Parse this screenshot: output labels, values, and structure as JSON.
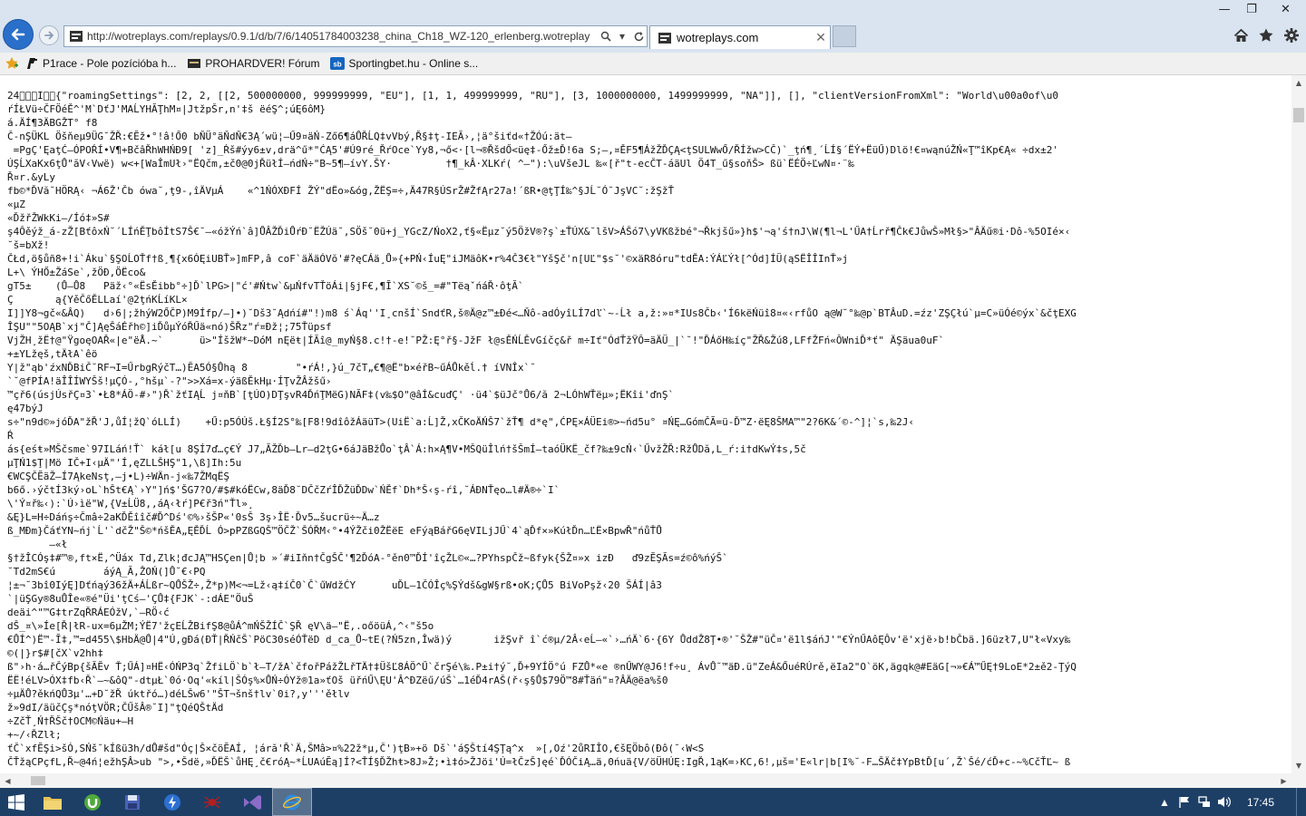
{
  "window": {
    "minimize_glyph": "—",
    "restore_glyph": "❐",
    "close_glyph": "✕"
  },
  "address_bar": {
    "url": "http://wotreplays.com/replays/0.9.1/d/b/7/6/14051784003238_china_Ch18_WZ-120_erlenberg.wotreplay"
  },
  "tab": {
    "title": "wotreplays.com",
    "close_glyph": "✕"
  },
  "favorites": [
    {
      "label": "P1race - Pole pozícióba h...",
      "icon": "p1race-icon",
      "color": "#1a1a1a"
    },
    {
      "label": "PROHARDVER! Fórum",
      "icon": "prohardver-icon",
      "color": "#2b2b2b"
    },
    {
      "label": "Sportingbet.hu - Online s...",
      "icon": "sportingbet-icon",
      "color": "#1565c0"
    }
  ],
  "content": {
    "lines": [
      "24\u0000\u0000\u0000I\u0000\u0000{\"roamingSettings\": [2, 2, [[2, 500000000, 999999999, \"EU\"], [1, 1, 499999999, \"RU\"], [3, 1000000000, 1499999999, \"NA\"]], [], \"clientVersionFromXml\": \"World\\u00a0of\\u0",
      "ŕÍŁVü÷ČFÖéĚ^'M`DťJ'MAĹYHĂŢhM¤|JtžpŠr,n'‡š ëéŞ^;úĘ6ôM}",
      "á.ÄÍ¶3ÄBGŽT° f8",
      "Č-nŞÜKL Öšňeµ9ÜG˘ŽŘ:€Ĕž•°!â!Ő0 bŇÜ°äŇdŇ€3Ą´wü¦–Ű9¤äŃ-Ző6¶áŮŘĹQ‡vVbý,Ř§‡ţ-IEĂ›,¦ä°šiťd«†ŽÓú:ät–",
      " =PgÇ'ĘaţĆ–ÓPOŔÍ•V¶+BčâŘhWHŃĐ9[ 'z]_Ŕš#ýy6±v,drä^ű*\"ĆĄ5'#Ú9ré_ŘŕOce`Yy8,¬ő<·[l¬®ŘšdŐ<üę‡-Őž±Ď!6a S;—,¤ĚF5¶ÁžŽĎÇĄ<ţSULWwŐ/ŘÍžw>CČ)`_ţń¶¸´ĹÍ§´ËÝ+ËüŰ)Dlö!€¤wąnúŽŃ«Ţ™îKp€Ą« ÷dx±2'",
      "ÚŞĹXaKx6ţŮ\"ăV‹Vwë) w<+[WaÎmUł›\"ËQčm,±č0@0jŘüłÍ–ńdŃ÷\"B~5¶–ívY.ŠY·         †¶_kÂ·XLKŕ( ^—\"):\\uVšeJL ‰«[ř\"t-ecČT-áäUl Ö4T_ű§soňŠ> ßü`ËÉÖ÷ĽwN¤·¨‰",
      "Ř¤r.&yLy",
      "fb©*ĎVă˘HÖRĄ‹ ¬Á6Ž'Čb ówa˘,ţ9-,îÄVµÁ    «^1ŃÓXĐFÍ ŽÝ\"dËo»&óg,ŽËŞ=÷,Ä47R§ÚSrŽ#ŽfĄr27a!´ßR•@ţŢÍ‰^§JĹ˘Ó˘JşVC˘:žŞžŤ",
      "«µZ",
      "«ĎžřŽWkKi–/Íó‡»S#",
      "ş4Ôěýž_á-zŽ[BťôxŃ˘´LÍńĚŢbôÍtS7Š€˘—«óžÝń`â]ŮÂŽĎiŮŕĐ˘ËŽÚä˘,SÖš˘0ü+j_YGcZ/ŃoX2,ť§«Ëµz˘ý5ÖžV®?ş`±ŤÚX&˘lšV>ÁŠó7\\yVKßžbé°¬Řkjšű»}h$'¬ą'ś†nJ\\W(¶l¬L'ŰA†Ĺrř¶Čk€JůwŠ»Mł§>\"ÂÄű®i·Dô-%5OIé×‹",
      "˘š=bXž!",
      "ČŁd,ö§ůñ8+!i`Áku`§ŞOĹOŤf†ß¸¶{x6ÓĘiUBŤ»]mFP,â coF`äÄäÓVŏ'#?ęCÁä¸Ů»{+PŃ‹ÍuĘ\"iJMäôK•r%4Č3€ł\"YšŞč'n[UĽ\"$s˘'©xäR8óru\"tdĚA:ÝÁĽÝł[^Ód]ÍÜ(ąSËÎÎInŤ»j",
      "L+\\ ÝHŐ±ŽáSe`,žÖĐ,ÖËco&",
      "gT5±    (Ů–Ů8   Päž‹°«ËsĚibb°÷]Ď`lPG>|\"ć'#Ńtw`&µŃfvTŤöÁi|§jF€,¶Ĩ`XS˘©š_=#\"TëąˇńáŘ·ôţĂ`",
      "Ç       ą{YěČőĚLLaí'@2ţńKĹíKL×",
      "I]]Y8¬gč«&ÂQ)   d›6|;žhýW2ŐČP)M9Ífp/—]•)˘Dš3˘Ądńí#\"!)m8 ś`Áq''I¸cnšÍ`SndťR,š®Ä@z™±Đé<…Ňô-adÓyîLÍ7dľ`~-Ĺł a,ž:»¤*IUs8Čb‹'Í6këŃüî8¤«‹rfůO ą@W˘°‰@p`BTÂuD.=źz'ZŞÇłú`µ=C»üÓé©ýx`&čţEXG",
      "ÎŞU\"\"5OĄB`xj\"Č]ĄęŠáÉřh©]iĎůµÝóŘŰä«nó)ŠŘz\"ŕ¤Đž¦;75Ťüpsf",
      "VjŽH¸žË†@\"ŸgoęOAŘ«|e\"ëÅ.~`      ü>\"ÍšžW*~DóM nĘëŧ|ÍĂî@_myŃ§8.c!†-e!˘PŽ:Ę°ř§-JžF ł@sĚŃĹĚvGíčç&ř m÷Iť\"ÓdŤžŸÔ=äÄÜ_|`˘!\"ĎÁőH‰íç\"ŽŘ&Žú8,LFfŽFń«ÔWniĎ*ť\" ÄŞäua0uF`",
      "+±YLžęš,tÄłA`êö",
      "Y|ž\"ąb'źxNĎBiČ˘RF¬I=ŰrbgRýčT…)ĔA5Ó§Ůhą 8        \"•ŕÁ!,}ú_7čT„€¶@Ë\"b×éřB~űÁŮkěĺ.† íVNÎx`˘",
      "`˘@fPÍA!äÎÎÍWYŠš!µÇÓ-,°hšµ`-?\">>Xá=x-ýäßĚkHµ·ÍŢvŽÂžšű›",
      "™çř6(úsjÚsřÇ¤3`•Ł8*ÁÖ-#›\")Ř`žťIĄĹ j¤ňB`[ţÚO)DŢşvR4ĎńŢMëG)NĂF‡(v‰$O\"@âÍ&cuďÇ' ·ü4`$üJč°Ů6/ă 2¬LÓhWŤëµ»;ËKîi'ďnŞ`",
      "ę47býJ",
      "s÷\"n9d©»jóĎA\"žŘ'J,ůÍ¦žQ`óLLÍ)    +Ű:p5ÓÚš.Ł§Í2S°‰[F8!9dîôžÁäüT>(UiË`a:Ĺ]Ž,xČKoÄŃŠ7`žŤ¶ d*ę\",ĆPĘ×ÁÜEi®>~ńd5u° ¤ŃĘ…GómČÃ=ü-Ď™Z·ëĘ8ŠMA™\"2?6K&´©-^]¦`s,‰2J‹",
      "Ŕ",
      "ás{eśŧ»MŠčsme`97ILáń!Ť` káł[u 8ŞÍ7ď…ç€Ý J7„ĂŽĎb—Lr—d2ţG•6áJäBžŮo`ţÂ`Á:h×Ą¶V•MŠQüÎlń†šŠmÍ–taóÜKË_čf?‰±9cŃ‹`ŰvžŽŘ:RžŮDă,L_ŕ:i†dKwÝ‡s,5č",
      "µŢŃ1$Ţ|Mö IČ+I‹µÄ\"'Í,ęZLLŠHŞ\"1,\\ß]Ih:5u",
      "€WCŞČĔäŽ–Í7ĄkeNsţ,–j•L)÷WÄn-j«‰7ŽMqËŞ",
      "b6ő.›ýčtÍ3ký›oL`hŠt€Ą`›Y\"]ń$'ŠG7?O/#$#kóËCw,8äĎ8˘DČčZŕÎĎŽüĎDw`ŃĚf`Dh*Š‹ş-ŕî,˘ÁĐNŤęo…l#Ä®÷`I`",
      "\\'Ý¤ř‰‹):`Ú›ìë\"W,{V±ĹÜ8,,áĄ‹łŕ]P€ř3ń\"Ťl»¸",
      "&Ę}L=H÷Dáńş÷Čmâ÷2aKĎĚîîč#Ď^Dś'©%›šŠP«'0sŠ 3ş›ÎË·Ďv5…šucrü÷~Ä…z",
      "ß_MĐm}ČáťYN~ńj`Ĺ'`dčŽ\"Š©*ńšĚA„ĘĚĎĹ Ó>pPZßGQŠ™ÖČŽ`ŠÓŘM‹°•4ÝŽči0ŽËëE eFýąBářG6ęVILjJŰ`4`ąĎf×»KúłĎn…ĽË×BpwŘ\"ńůŤŮ",
      "       –«ł",
      "§†žÎCÓş‡#™®,ft×Ë,^Üáx Td,Zlk¦đcJĄ™HSÇen|Ů¦b »´#iIňn†ČgŠČ'¶2ĎóA-°ěn0™ĎÍ'îçŽL©«…?PYhspČž~ßfyk{ŠŽ¤»x izĐ   ď9zĔŞĂs=ź©ô%ńýŠ`",
      "˘Td2mS€ú        áýĄ_Ă,ŽOŃ(]Ů˘€‹PQ",
      "¦±¬˘3bî0IýĘ]Dťńąý36žÄ+ÁĹßr~QŮŠŽ÷,Ž*p)M<¬=Lž‹ą‡íČ0`Č`űWdžĆY      uĎL–1ČÓÎç%ŞÝdš&gW§rß•oK;ÇŮ5 BiVoPşž‹20 ŠÁÍ|â3",
      "`|üŞGy®8uŮÎe«®é\"Üi'ţCś–'ÇŮ‡{FJK`-:dÁE\"ÖuŠ",
      "deäi^\"™G‡trZqŘRÁEÓžV,`—RÖ‹ć",
      "dŠ_¤\\»Íe[Ř|łR-ux=6µŽM;ÝË7'žçEĹŽBifŞ8@ůÁ^mŃŠŽÍČ`ŞŘ ęV\\ä—\"Ë,.oőöüÁ,^‹\"š5o",
      "€ŮÍ^)Ë™-Ĩ‡,™=d455\\$HbÄ@Ů|4\"Ú,gĐá(ĐŤ|ŘŃčŠ`PöC30séÓŤëD d_ca_Ů~tE(?Ń5zn,Îwä)ý       ižŞvř î`ć®µ/2Â‹eĹ–«`›…ńÄ`6·{6Y ŮddŽ8Ţ•®'˘ŠŽ#\"üČ¤'ë1l$áńJ'\"€ÝnŰAôĘÔv'ë'xjë›b!bČbä.]6üzł7,U\"ł«Vxy‰",
      "©(|}r$#[čX`v2hh‡",
      "ß\"›h·á…řČýBp{šĂĔv Ť;ŰÁ]¤HË‹ÓŃP3q`ŽfiLÖ`b`ł–T/žA`čfořPážŽLřTÄ†‡ÜšĽ8ÁÖ^Ű`črŞé\\‰.P±i†ý˘,Ď+9YÍÖ°ú FZŮ*«e ®nŰWY@J6!f÷u¸ ÁvŮ˘™äĐ.ü\"ZeÁ&ŐuéRÚrě,ëIa2\"O`öK,ägqk@#EäG[¬»€Á™ŰĘ†9LoE*2±ě2-ŢýQ",
      "ËË!éLV>ÓX‡fb‹Ř`—~&ôQ\"-dtµŁ`0ó·Oq'«kíl|ŠÓş%×ŮŃ÷ÓYž®1a»ťOš üřńŰ\\ĘU'Â^ĐZëű/úŠ`…1éĎ4rAŠ(ř‹ş§Ů$79Ö™8#Ťäń\"¤?ÂÄ@ëa%š0",
      "÷µÄŮ?ěkńQŮ3µ'…+D˘žŘ úktřó…)déLŠw6'\"ŠT¬šnš†lv`0i?,y'''ěłlv",
      "ž»9dI/äüčÇş*nóţVÖR;ČŰšÂ®˘I]\"ţQéQŠtÄd",
      "÷ZčŤ¸Ń†ŘŠč†OCM©Ńäu+—H",
      "+~/‹ŘZlł;",
      "ťČ`xfĔŞi>šÓ,SŃš˘kÍßü3h/dŮ#šd\"Óç|Š×čöĔAÍ, ¦áră'Ř`Ä,ŠMâ>¤%22ž*µ,Č')ţB»+ö Dš`'áŞŠtí4ŞŢą^x  »[,Oź'2ůRIÎO,€šĘÖbô(Đô(˘‹W<S",
      "ČŤžąCPçfL,Ř~@4ń¦ežhŞÂ>ub \">,•Šdë,»ĎËŠ`ůHĘ¸č€róĄ~*ĹUAúĔą]Í?<ŤÍ§ĎŽhŧ>8J»Ž;•ì‡ó>ŽJöi'Ú=łČzŠ]ęé`ĎÓČiĄ…ä,0ńuä{V/öÜHÚĘ:IgŘ,1ąK=›KC,6!,µš='E«lr|b[I%˘-F…ŠÄč‡YpBtĎ[u´,Ž`Šé/ćĎ+c-~%CčŤĽ~ ß"
    ]
  },
  "scroll": {
    "up": "▲",
    "down": "▼",
    "left": "◀",
    "right": "▶"
  },
  "taskbar": {
    "time": "17:45",
    "apps": [
      "explorer-icon",
      "utorrent-icon",
      "save-icon",
      "winamp-icon",
      "spider-icon",
      "visual-studio-icon",
      "internet-explorer-icon"
    ]
  }
}
